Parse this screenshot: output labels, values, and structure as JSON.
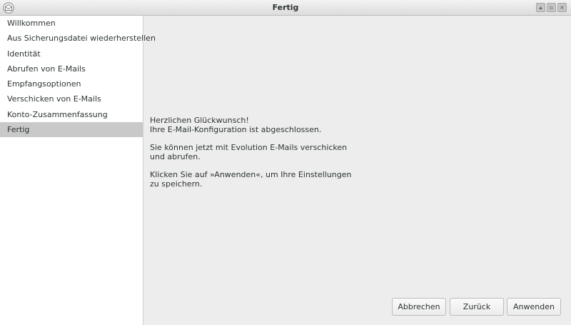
{
  "window": {
    "title": "Fertig",
    "app_icon": "evolution-envelope-icon"
  },
  "sidebar": {
    "items": [
      {
        "label": "Willkommen"
      },
      {
        "label": "Aus Sicherungsdatei wiederherstellen"
      },
      {
        "label": "Identität"
      },
      {
        "label": "Abrufen von E-Mails"
      },
      {
        "label": "Empfangsoptionen"
      },
      {
        "label": "Verschicken von E-Mails"
      },
      {
        "label": "Konto-Zusammenfassung"
      },
      {
        "label": "Fertig",
        "active": true
      }
    ]
  },
  "content": {
    "line1": "Herzlichen Glückwunsch!",
    "line2": "Ihre E-Mail-Konfiguration ist abgeschlossen.",
    "paragraph2": "Sie können jetzt mit Evolution E-Mails verschicken und abrufen.",
    "paragraph3": "Klicken Sie auf »Anwenden«, um Ihre Einstellungen zu speichern."
  },
  "buttons": {
    "cancel": "Abbrechen",
    "back": "Zurück",
    "apply": "Anwenden"
  }
}
